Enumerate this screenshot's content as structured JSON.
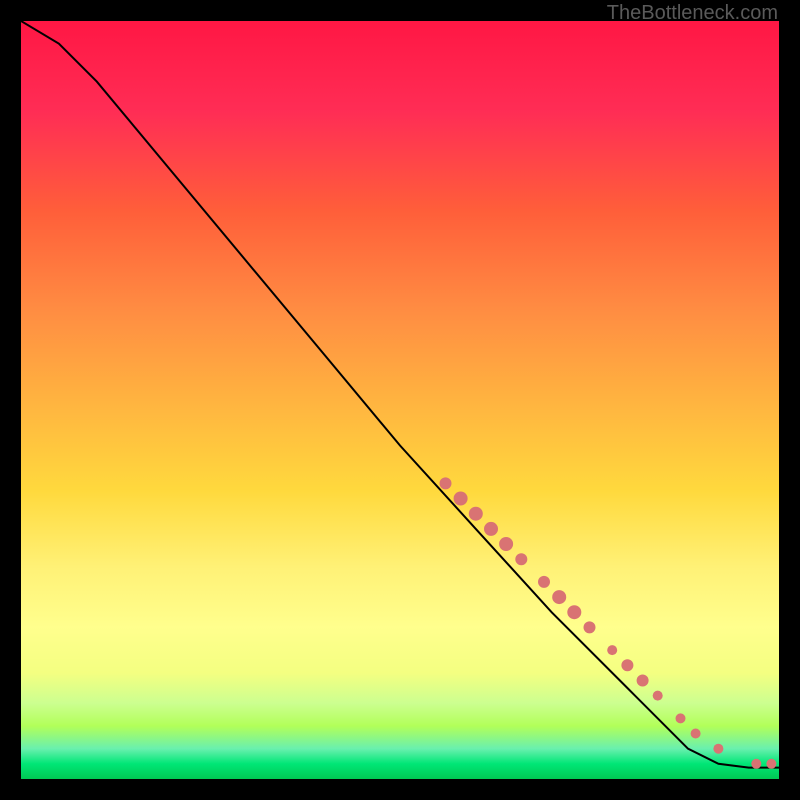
{
  "watermark": "TheBottleneck.com",
  "chart_data": {
    "type": "line",
    "title": "",
    "xlabel": "",
    "ylabel": "",
    "xlim": [
      0,
      100
    ],
    "ylim": [
      0,
      100
    ],
    "curve_points": [
      {
        "x": 0,
        "y": 100
      },
      {
        "x": 5,
        "y": 97
      },
      {
        "x": 10,
        "y": 92
      },
      {
        "x": 15,
        "y": 86
      },
      {
        "x": 20,
        "y": 80
      },
      {
        "x": 30,
        "y": 68
      },
      {
        "x": 40,
        "y": 56
      },
      {
        "x": 50,
        "y": 44
      },
      {
        "x": 60,
        "y": 33
      },
      {
        "x": 70,
        "y": 22
      },
      {
        "x": 80,
        "y": 12
      },
      {
        "x": 88,
        "y": 4
      },
      {
        "x": 92,
        "y": 2
      },
      {
        "x": 96,
        "y": 1.5
      },
      {
        "x": 100,
        "y": 1.5
      }
    ],
    "data_points": [
      {
        "x": 56,
        "y": 39,
        "r": 6
      },
      {
        "x": 58,
        "y": 37,
        "r": 7
      },
      {
        "x": 60,
        "y": 35,
        "r": 7
      },
      {
        "x": 62,
        "y": 33,
        "r": 7
      },
      {
        "x": 64,
        "y": 31,
        "r": 7
      },
      {
        "x": 66,
        "y": 29,
        "r": 6
      },
      {
        "x": 69,
        "y": 26,
        "r": 6
      },
      {
        "x": 71,
        "y": 24,
        "r": 7
      },
      {
        "x": 73,
        "y": 22,
        "r": 7
      },
      {
        "x": 75,
        "y": 20,
        "r": 6
      },
      {
        "x": 78,
        "y": 17,
        "r": 5
      },
      {
        "x": 80,
        "y": 15,
        "r": 6
      },
      {
        "x": 82,
        "y": 13,
        "r": 6
      },
      {
        "x": 84,
        "y": 11,
        "r": 5
      },
      {
        "x": 87,
        "y": 8,
        "r": 5
      },
      {
        "x": 89,
        "y": 6,
        "r": 5
      },
      {
        "x": 92,
        "y": 4,
        "r": 5
      },
      {
        "x": 97,
        "y": 2,
        "r": 5
      },
      {
        "x": 99,
        "y": 2,
        "r": 5
      }
    ],
    "gradient_stops": [
      {
        "offset": 0,
        "color": "#ff1744"
      },
      {
        "offset": 12,
        "color": "#ff2d55"
      },
      {
        "offset": 25,
        "color": "#ff5e3a"
      },
      {
        "offset": 38,
        "color": "#ff8c42"
      },
      {
        "offset": 50,
        "color": "#ffb340"
      },
      {
        "offset": 62,
        "color": "#ffd93d"
      },
      {
        "offset": 72,
        "color": "#fff176"
      },
      {
        "offset": 80,
        "color": "#ffff8d"
      },
      {
        "offset": 86,
        "color": "#f4ff81"
      },
      {
        "offset": 90,
        "color": "#ccff90"
      },
      {
        "offset": 93,
        "color": "#b2ff59"
      },
      {
        "offset": 96,
        "color": "#69f0ae"
      },
      {
        "offset": 98,
        "color": "#00e676"
      },
      {
        "offset": 100,
        "color": "#00c853"
      }
    ],
    "point_color": "#d97373",
    "curve_color": "#000000"
  }
}
